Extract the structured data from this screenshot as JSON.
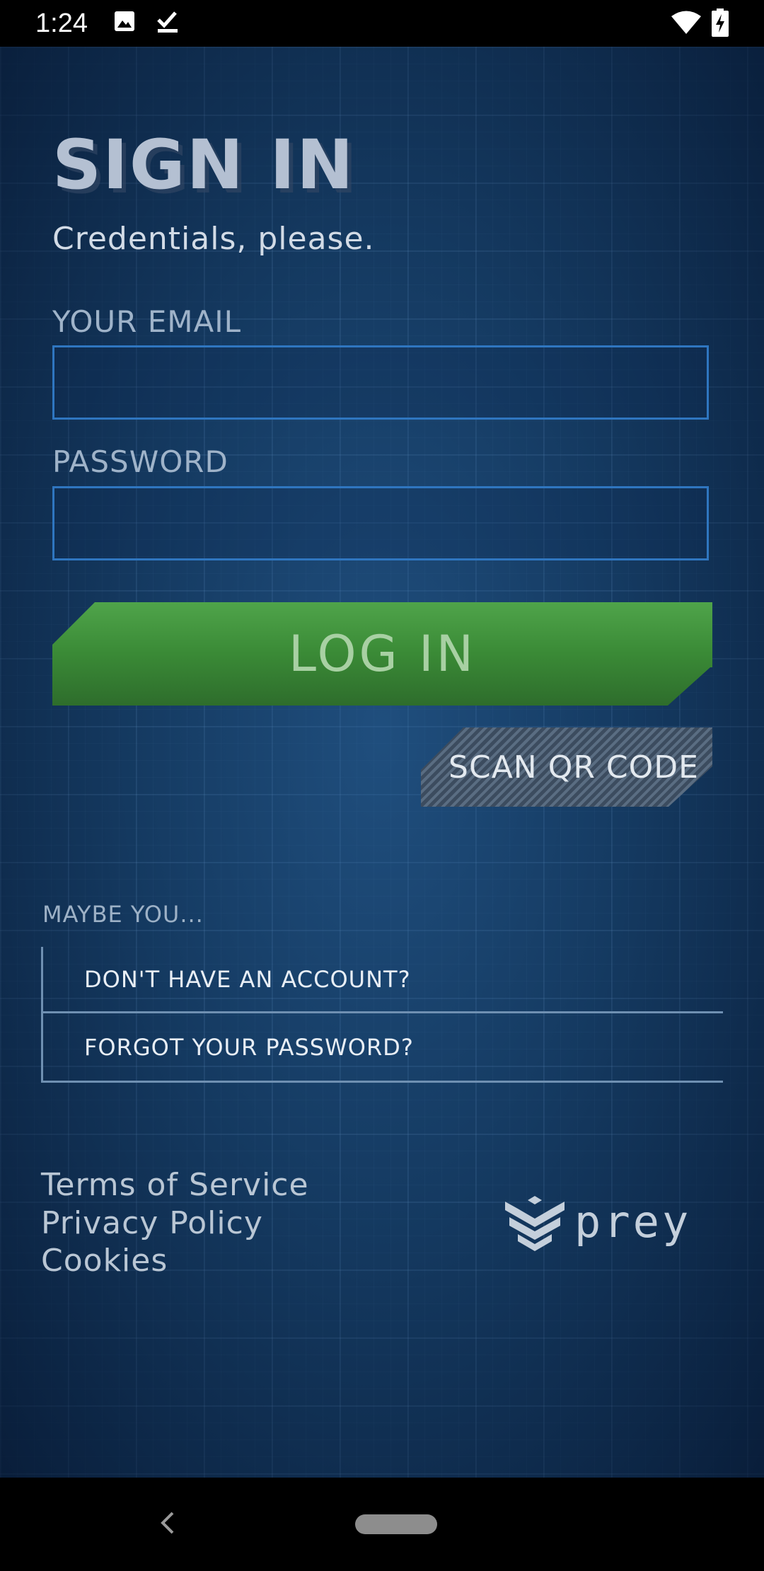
{
  "status_bar": {
    "time": "1:24",
    "left_icons": [
      "image-icon",
      "download-check-icon"
    ],
    "right_icons": [
      "wifi-icon",
      "battery-charging-icon"
    ]
  },
  "sign_in": {
    "title": "SIGN IN",
    "subtitle": "Credentials, please.",
    "email_label": "YOUR EMAIL",
    "email_value": "",
    "password_label": "PASSWORD",
    "password_value": "",
    "login_label": "LOG IN",
    "scan_qr_label": "SCAN QR CODE"
  },
  "alternatives": {
    "heading": "MAYBE YOU...",
    "no_account": "DON'T HAVE AN ACCOUNT?",
    "forgot_password": "FORGOT YOUR PASSWORD?"
  },
  "footer": {
    "terms": "Terms of Service",
    "privacy": "Privacy Policy",
    "cookies": "Cookies",
    "brand": "prey"
  },
  "colors": {
    "background": "#153a60",
    "field_border": "#2f76c0",
    "login_green": "#3a8a36",
    "text_muted": "#9fb3c9"
  }
}
